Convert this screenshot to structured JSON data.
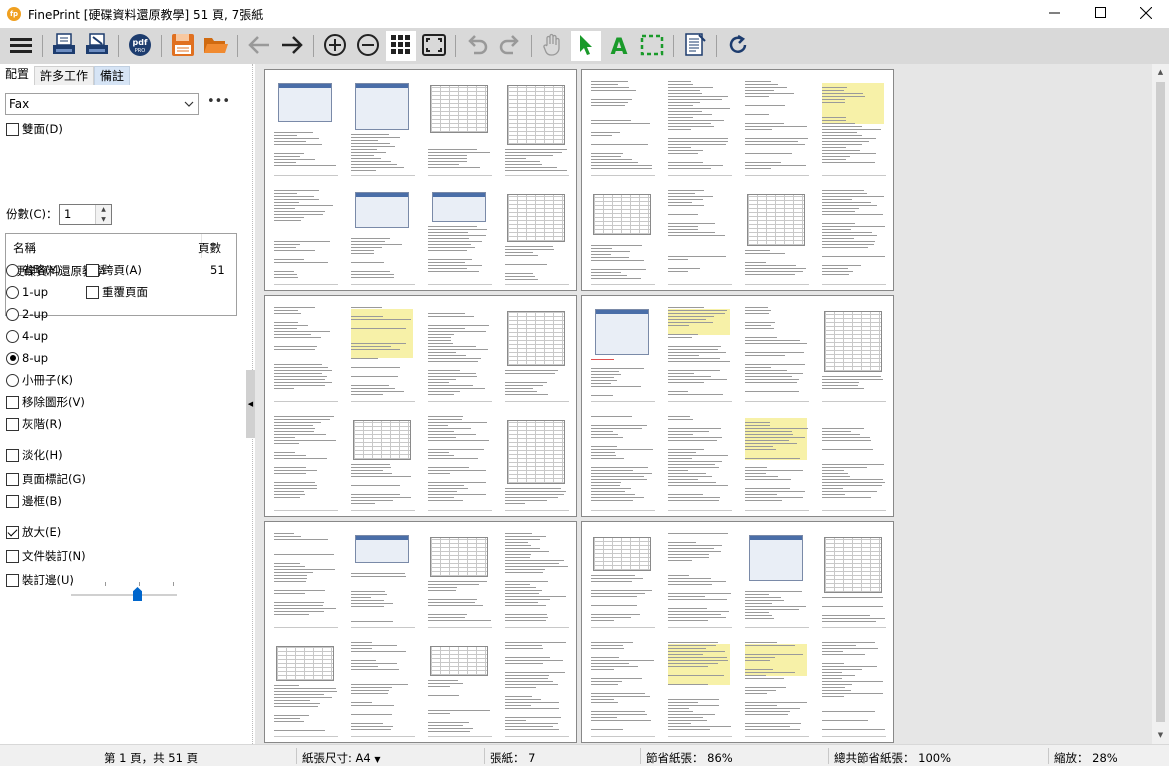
{
  "window": {
    "title": "FinePrint [硬碟資料還原教學] 51 頁, 7張紙",
    "logo_text": "fp",
    "minimize": "—",
    "maximize": "☐",
    "close": "✕"
  },
  "toolbar": {
    "buttons": [
      "menu-icon",
      "print-icon",
      "print-edit-icon",
      "pdf-pro-icon",
      "save-icon",
      "open-folder-icon",
      "back-arrow-icon",
      "forward-arrow-icon",
      "zoom-in-icon",
      "zoom-out-icon",
      "grid-view-icon",
      "fit-page-icon",
      "undo-icon",
      "redo-icon",
      "hand-tool-icon",
      "select-arrow-icon",
      "text-tool-icon",
      "marquee-select-icon",
      "edit-page-icon",
      "refresh-icon"
    ],
    "pdf_label": "pdf",
    "pdf_sub": "PRO",
    "text_tool": "A"
  },
  "tabs": [
    "配置",
    "許多工作",
    "備註"
  ],
  "printer": {
    "selected": "Fax",
    "more": "•••"
  },
  "options": {
    "duplex": "雙面(D)",
    "copies_label": "份數(C)：",
    "copies_value": "1"
  },
  "doc_list": {
    "col_name": "名稱",
    "col_pages": "頁數",
    "rows": [
      {
        "name": "硬碟資料還原教學",
        "pages": "51"
      }
    ]
  },
  "layout_options": {
    "omit": "省略(Y)",
    "span": "跨頁(A)",
    "one_up": "1-up",
    "overlay": "重覆頁面",
    "two_up": "2-up",
    "four_up": "4-up",
    "eight_up": "8-up",
    "booklet": "小冊子(K)",
    "remove_graphics": "移除圖形(V)",
    "grayscale": "灰階(R)",
    "fade": "淡化(H)",
    "page_marks": "頁面標記(G)",
    "border": "邊框(B)",
    "enlarge": "放大(E)",
    "doc_binding": "文件裝訂(N)",
    "binding_margin": "裝訂邊(U)",
    "enlarge_level": 0.65
  },
  "status": {
    "page": "第 1 頁，共 51 頁",
    "paper_size": "紙張尺寸: A4",
    "sheets": "張紙： 7",
    "saved": "節省紙張： 86%",
    "total_saved": "總共節省紙張： 100%",
    "zoom": "縮放： 28%"
  },
  "colors": {
    "toolbar_bg": "#d9d9d9",
    "accent_blue": "#0066cc",
    "save_orange": "#e07020",
    "green_tool": "#1a9a2a"
  }
}
